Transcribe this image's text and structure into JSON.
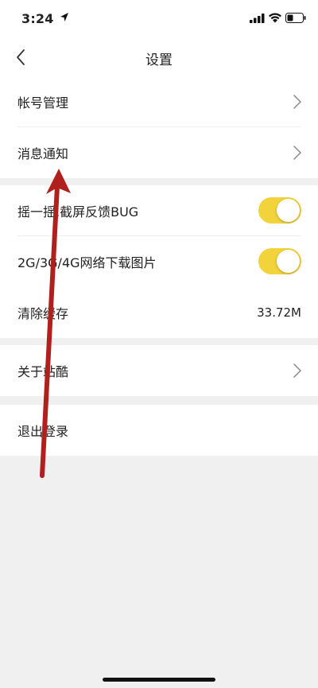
{
  "status_bar": {
    "time": "3:24",
    "icons": [
      "location-arrow-icon",
      "signal-icon",
      "wifi-icon",
      "battery-icon"
    ]
  },
  "nav": {
    "title": "设置",
    "back_icon": "chevron-left-icon"
  },
  "sections": {
    "account": {
      "items": [
        {
          "label": "帐号管理",
          "icon": "chevron-right-icon"
        },
        {
          "label": "消息通知",
          "icon": "chevron-right-icon"
        }
      ]
    },
    "preferences": {
      "items": [
        {
          "label": "摇一摇,截屏反馈BUG",
          "toggle_on": true
        },
        {
          "label": "2G/3G/4G网络下载图片",
          "toggle_on": true
        },
        {
          "label": "清除缓存",
          "value": "33.72M"
        }
      ]
    },
    "about": {
      "label": "关于站酷",
      "icon": "chevron-right-icon"
    },
    "logout": {
      "label": "退出登录"
    }
  },
  "colors": {
    "toggle_on": "#f2d33c",
    "background": "#f0f0f0",
    "annotation_arrow": "#b0201c"
  }
}
